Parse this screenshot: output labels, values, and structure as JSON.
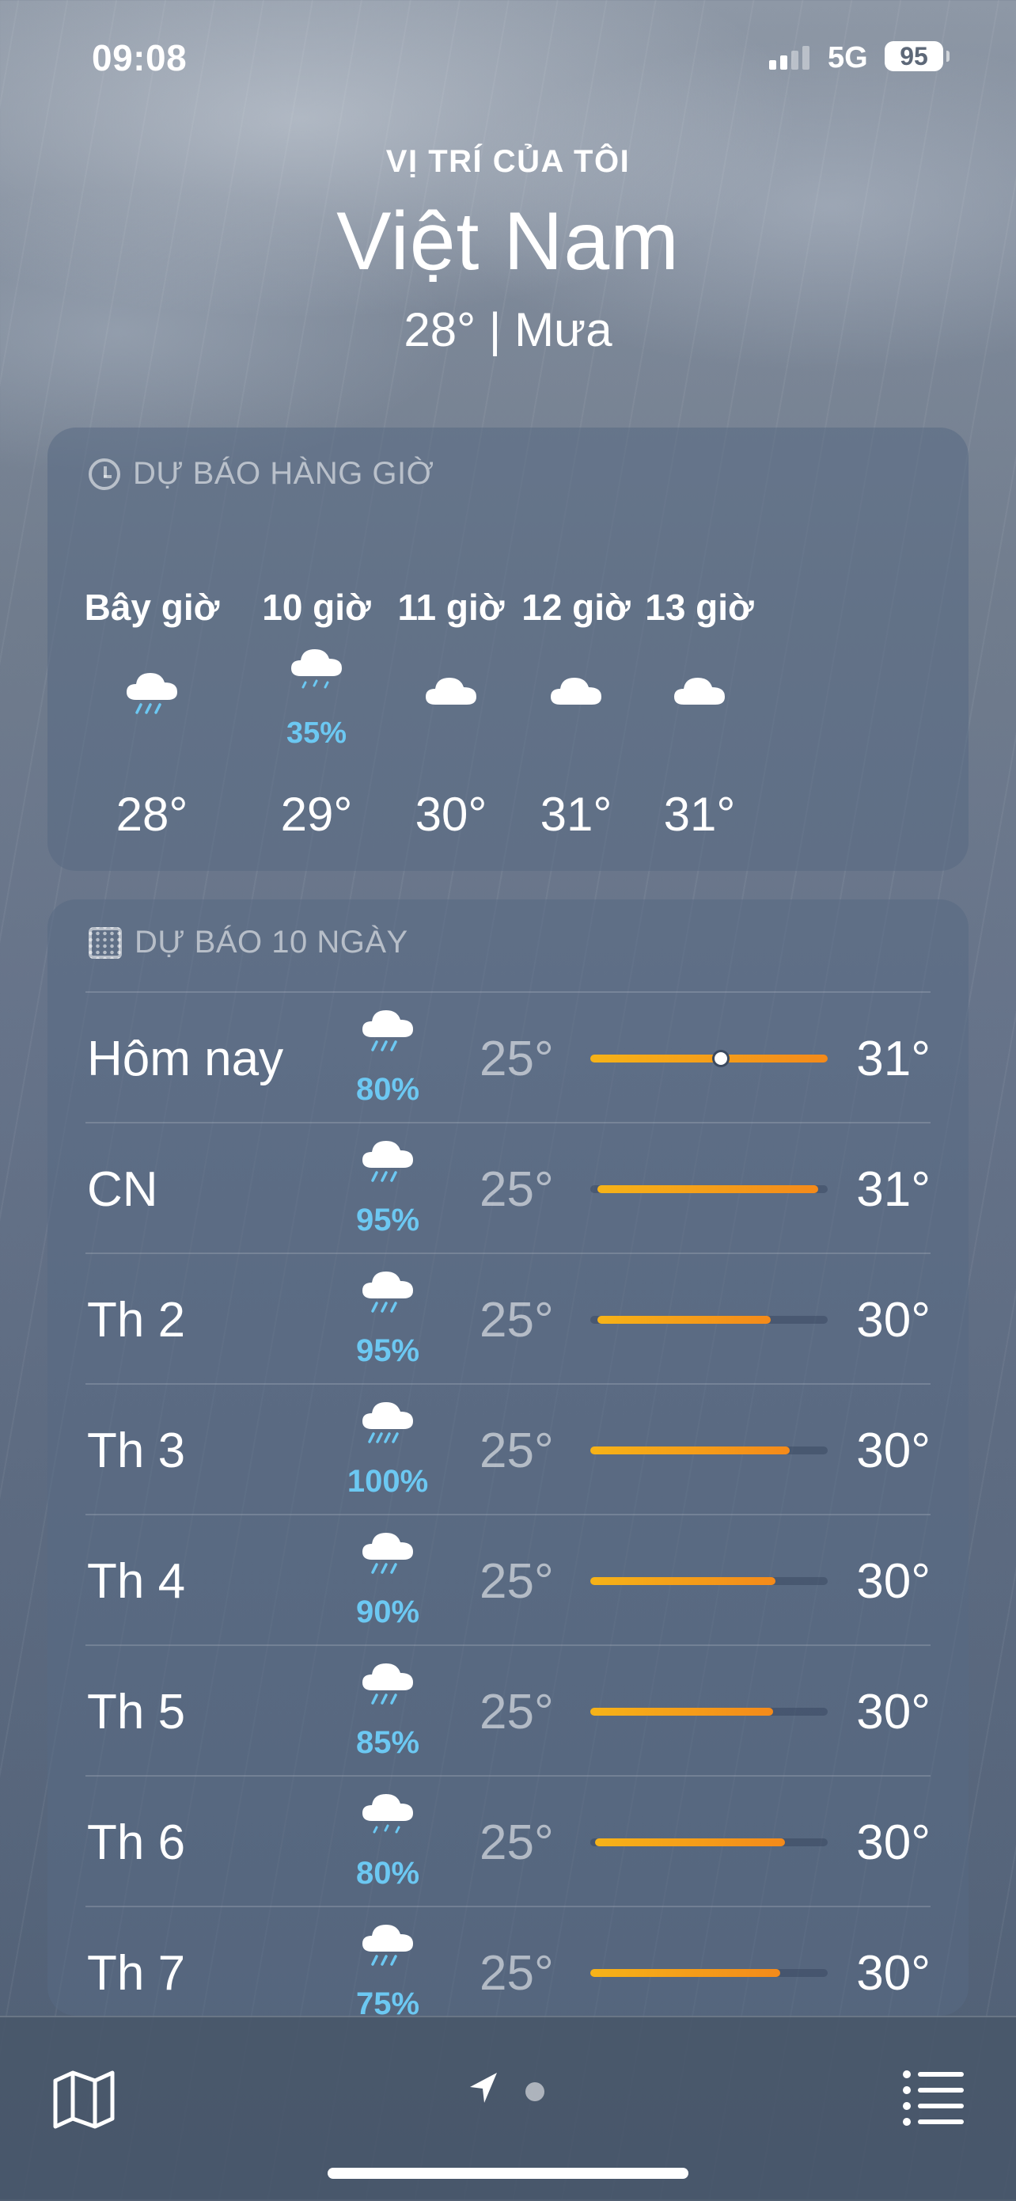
{
  "status_bar": {
    "time": "09:08",
    "network": "5G",
    "battery": "95"
  },
  "header": {
    "location_label": "VỊ TRÍ CỦA TÔI",
    "city": "Việt Nam",
    "summary": "28° | Mưa"
  },
  "hourly": {
    "title": "DỰ BÁO HÀNG GIỜ",
    "items": [
      {
        "time": "Bây giờ",
        "icon": "rain-icon",
        "pop": "",
        "temp": "28°"
      },
      {
        "time": "10 giờ",
        "icon": "drizzle-icon",
        "pop": "35%",
        "temp": "29°"
      },
      {
        "time": "11 giờ",
        "icon": "cloud-icon",
        "pop": "",
        "temp": "30°"
      },
      {
        "time": "12 giờ",
        "icon": "cloud-icon",
        "pop": "",
        "temp": "31°"
      },
      {
        "time": "13 giờ",
        "icon": "cloud-icon",
        "pop": "",
        "temp": "31°"
      }
    ]
  },
  "daily": {
    "title": "DỰ BÁO 10 NGÀY",
    "range": {
      "min": 25,
      "max": 31
    },
    "items": [
      {
        "day": "Hôm nay",
        "icon": "rain-icon",
        "pop": "80%",
        "low": "25°",
        "high": "31°",
        "bar_start": 0.0,
        "bar_end": 1.0,
        "current": 0.55
      },
      {
        "day": "CN",
        "icon": "rain-icon",
        "pop": "95%",
        "low": "25°",
        "high": "31°",
        "bar_start": 0.03,
        "bar_end": 0.96
      },
      {
        "day": "Th 2",
        "icon": "rain-icon",
        "pop": "95%",
        "low": "25°",
        "high": "30°",
        "bar_start": 0.03,
        "bar_end": 0.76
      },
      {
        "day": "Th 3",
        "icon": "heavy-rain-icon",
        "pop": "100%",
        "low": "25°",
        "high": "30°",
        "bar_start": 0.0,
        "bar_end": 0.84
      },
      {
        "day": "Th 4",
        "icon": "rain-icon",
        "pop": "90%",
        "low": "25°",
        "high": "30°",
        "bar_start": -0.02,
        "bar_end": 0.78
      },
      {
        "day": "Th 5",
        "icon": "rain-icon",
        "pop": "85%",
        "low": "25°",
        "high": "30°",
        "bar_start": -0.01,
        "bar_end": 0.77
      },
      {
        "day": "Th 6",
        "icon": "drizzle-icon",
        "pop": "80%",
        "low": "25°",
        "high": "30°",
        "bar_start": 0.02,
        "bar_end": 0.82
      },
      {
        "day": "Th 7",
        "icon": "rain-icon",
        "pop": "75%",
        "low": "25°",
        "high": "30°",
        "bar_start": -0.01,
        "bar_end": 0.8
      }
    ]
  },
  "bottom_bar": {
    "left_icon": "map-icon",
    "center_icons": [
      "location-arrow-icon",
      "page-dot"
    ],
    "right_icon": "list-icon"
  },
  "colors": {
    "accent_precip": "#6cc8f2",
    "bar_start": "#f6b318",
    "bar_end": "#f48a1a"
  }
}
